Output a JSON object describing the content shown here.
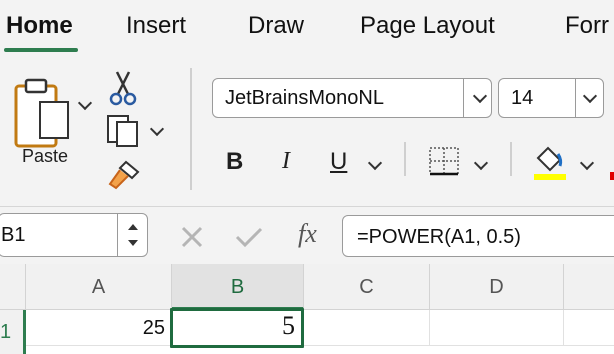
{
  "ribbon": {
    "tabs": [
      {
        "label": "Home",
        "active": true
      },
      {
        "label": "Insert",
        "active": false
      },
      {
        "label": "Draw",
        "active": false
      },
      {
        "label": "Page Layout",
        "active": false
      },
      {
        "label": "Forr",
        "active": false
      }
    ],
    "paste_label": "Paste",
    "font_name": "JetBrainsMonoNL",
    "font_size": "14",
    "bold_glyph": "B",
    "italic_glyph": "I",
    "underline_glyph": "U"
  },
  "formula_bar": {
    "name_box": "B1",
    "fx_glyph": "fx",
    "formula": "=POWER(A1, 0.5)"
  },
  "sheet": {
    "columns": [
      "A",
      "B",
      "C",
      "D"
    ],
    "row_number": "1",
    "A1": "25",
    "B1": "5"
  },
  "colors": {
    "accent_green": "#2e7d4f",
    "highlight_yellow": "#ffff00",
    "font_color_red": "#e00000"
  }
}
